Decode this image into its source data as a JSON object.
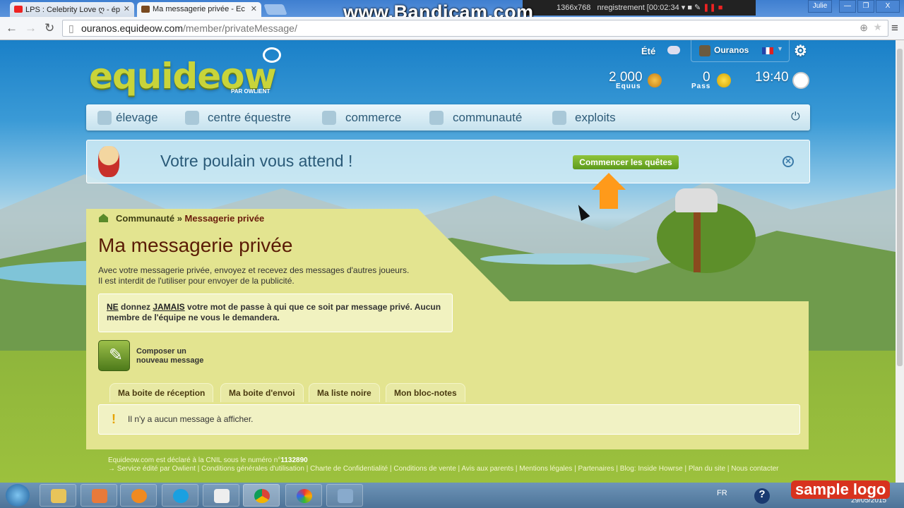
{
  "browser": {
    "tabs": [
      {
        "title": "LPS : Celebrity Love ღ - ép",
        "active": false
      },
      {
        "title": "Ma messagerie privée - Ec",
        "active": true
      }
    ],
    "url_host": "ouranos.equideow.com",
    "url_path": "/member/privateMessage/",
    "user": "Julie"
  },
  "recorder": {
    "watermark": "www.Bandicam.com",
    "resolution": "1366x768",
    "status": "nregistrement [00:02:34"
  },
  "site": {
    "logo": "equideow",
    "logo_sub": "PAR OWLIENT",
    "season": "Été",
    "username": "Ouranos",
    "equus_value": "2 000",
    "equus_label": "Equus",
    "pass_value": "0",
    "pass_label": "Pass",
    "time": "19:40",
    "nav": [
      "élevage",
      "centre équestre",
      "commerce",
      "communauté",
      "exploits"
    ],
    "banner_text": "Votre poulain vous attend !",
    "banner_button": "Commencer les quêtes"
  },
  "content": {
    "breadcrumb_parent": "Communauté",
    "breadcrumb_sep": "»",
    "breadcrumb_current": "Messagerie privée",
    "title": "Ma messagerie privée",
    "intro_1": "Avec votre messagerie privée, envoyez et recevez des messages d'autres joueurs.",
    "intro_2": "Il est interdit de l'utiliser pour envoyer de la publicité.",
    "warn_ne": "NE",
    "warn_donnez": " donnez ",
    "warn_jamais": "JAMAIS",
    "warn_rest": " votre mot de passe à qui que ce soit par message privé. Aucun membre de l'équipe ne vous le demandera.",
    "compose_1": "Composer un",
    "compose_2": "nouveau message",
    "tabs": [
      "Ma boite de réception",
      "Ma boite d'envoi",
      "Ma liste noire",
      "Mon bloc-notes"
    ],
    "empty": "Il n'y a aucun message à afficher."
  },
  "footer": {
    "cnil": "Equideow.com est déclaré à la CNIL sous le numéro n°",
    "cnil_num": "1132890",
    "links": "Service édité par Owlient | Conditions générales d'utilisation | Charte de Confidentialité | Conditions de vente | Avis aux parents | Mentions légales | Partenaires | Blog: Inside Howrse | Plan du site | Nous contacter"
  },
  "taskbar": {
    "lang": "FR",
    "date": "29/05/2015",
    "overlay": "sample logo"
  }
}
